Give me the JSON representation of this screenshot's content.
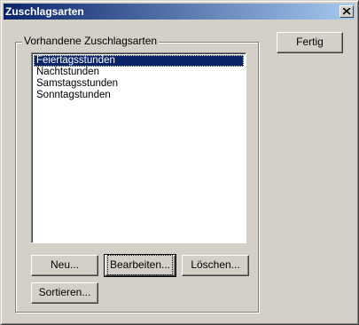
{
  "window": {
    "title": "Zuschlagsarten"
  },
  "group": {
    "label": "Vorhandene Zuschlagsarten"
  },
  "list": {
    "items": [
      "Feiertagsstunden",
      "Nachtstunden",
      "Samstagsstunden",
      "Sonntagstunden"
    ],
    "selected_index": 0
  },
  "buttons": {
    "done": "Fertig",
    "new": "Neu...",
    "edit": "Bearbeiten...",
    "delete": "Löschen...",
    "sort": "Sortieren..."
  },
  "icons": {
    "close": "close-icon"
  },
  "colors": {
    "titlebar_start": "#0a246a",
    "titlebar_end": "#a6caf0",
    "selection": "#0a246a",
    "face": "#d4d0c8"
  }
}
